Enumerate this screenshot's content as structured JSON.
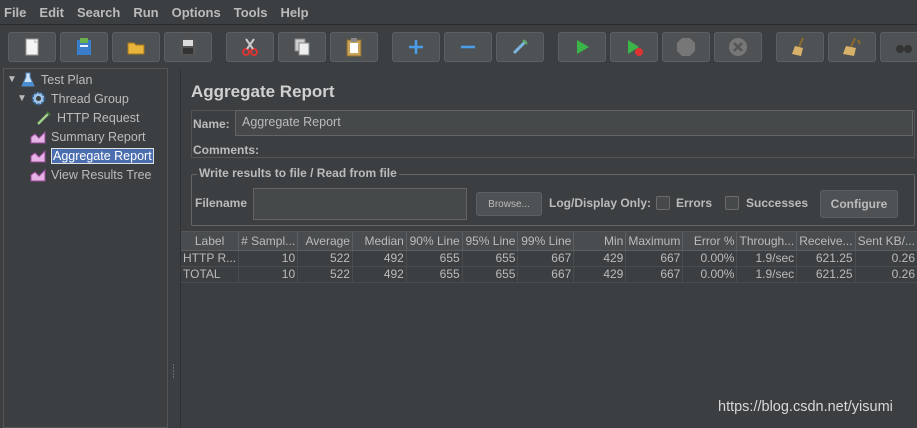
{
  "menu": [
    "File",
    "Edit",
    "Search",
    "Run",
    "Options",
    "Tools",
    "Help"
  ],
  "toolbar": {
    "buttons": [
      "new",
      "templates",
      "open",
      "save",
      "cut",
      "copy",
      "paste",
      "expand",
      "collapse",
      "toggle",
      "start",
      "start-no-pause",
      "stop",
      "shutdown",
      "clear",
      "clear-all",
      "search"
    ]
  },
  "tree": {
    "items": [
      {
        "label": "Test Plan",
        "icon": "flask-icon"
      },
      {
        "label": "Thread Group",
        "icon": "gear-icon"
      },
      {
        "label": "HTTP Request",
        "icon": "pipette-icon"
      },
      {
        "label": "Summary Report",
        "icon": "chart-icon"
      },
      {
        "label": "Aggregate Report",
        "icon": "chart-icon"
      },
      {
        "label": "View Results Tree",
        "icon": "chart-icon"
      }
    ],
    "selected": "Aggregate Report"
  },
  "panel": {
    "title": "Aggregate Report",
    "name_label": "Name:",
    "name_value": "Aggregate Report",
    "comments_label": "Comments:",
    "file_section": "Write results to file / Read from file",
    "filename_label": "Filename",
    "browse_label": "Browse...",
    "log_display_label": "Log/Display Only:",
    "errors_label": "Errors",
    "successes_label": "Successes",
    "configure_label": "Configure"
  },
  "table": {
    "headers": [
      "Label",
      "# Sampl...",
      "Average",
      "Median",
      "90% Line",
      "95% Line",
      "99% Line",
      "Min",
      "Maximum",
      "Error %",
      "Through...",
      "Receive...",
      "Sent KB/..."
    ],
    "rows": [
      [
        "HTTP R...",
        "10",
        "522",
        "492",
        "655",
        "655",
        "667",
        "429",
        "667",
        "0.00%",
        "1.9/sec",
        "621.25",
        "0.26"
      ],
      [
        "TOTAL",
        "10",
        "522",
        "492",
        "655",
        "655",
        "667",
        "429",
        "667",
        "0.00%",
        "1.9/sec",
        "621.25",
        "0.26"
      ]
    ]
  },
  "watermark": "https://blog.csdn.net/yisumi"
}
